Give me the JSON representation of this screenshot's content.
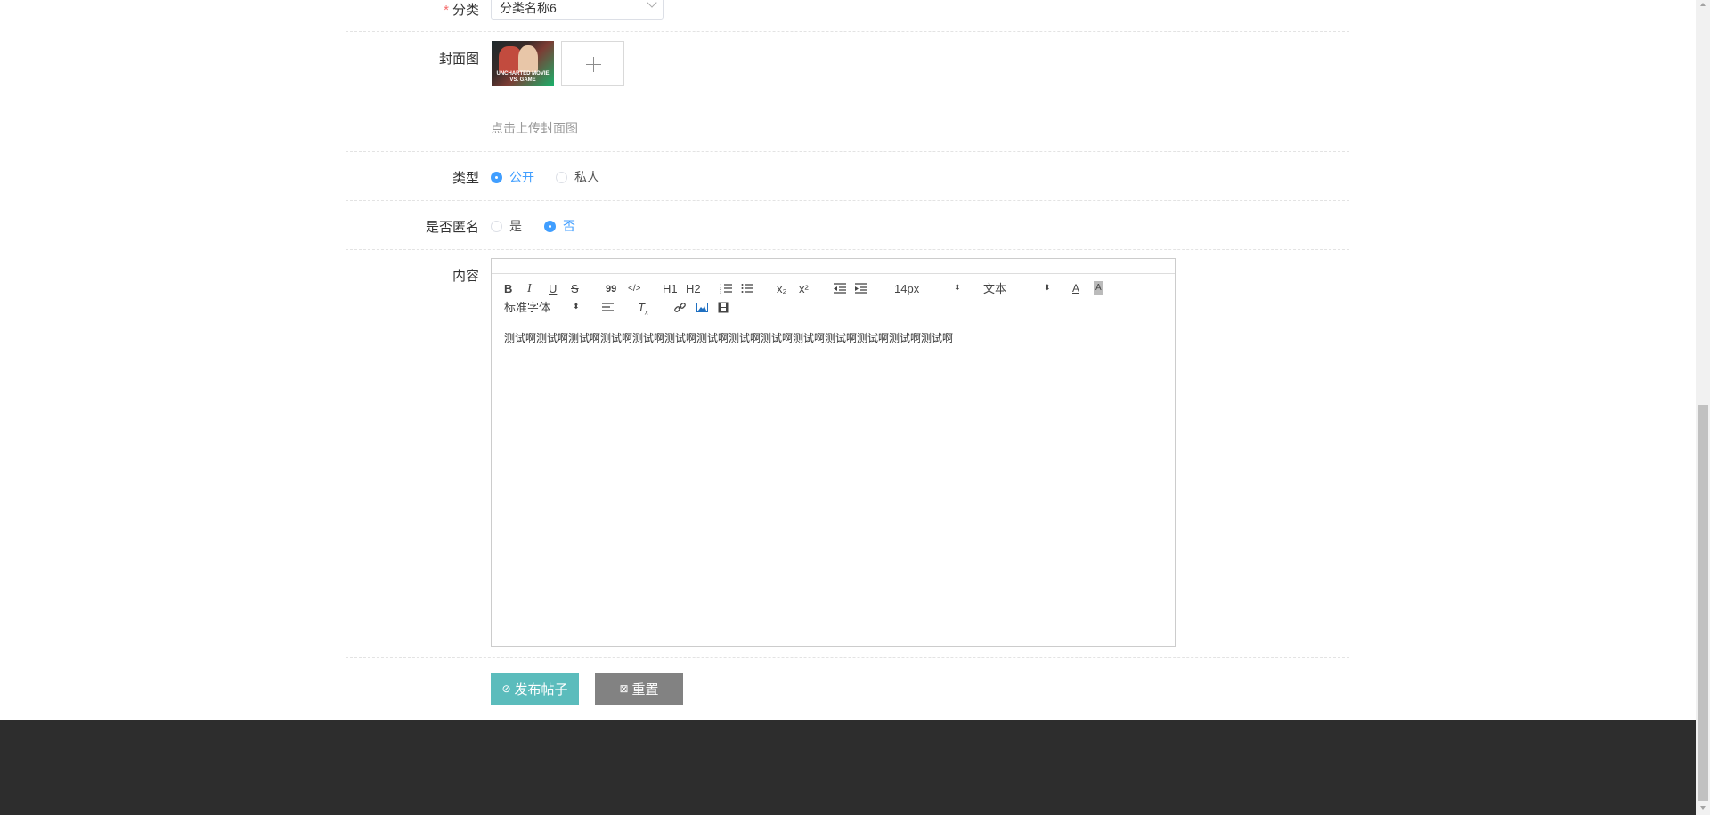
{
  "form": {
    "category": {
      "label": "分类",
      "value": "分类名称6"
    },
    "cover": {
      "label": "封面图",
      "hint": "点击上传封面图",
      "thumb_caption": "UNCHARTED MOVIE VS. GAME"
    },
    "type": {
      "label": "类型",
      "options": [
        "公开",
        "私人"
      ],
      "selected": "公开"
    },
    "anonymous": {
      "label": "是否匿名",
      "options": [
        "是",
        "否"
      ],
      "selected": "否"
    },
    "content": {
      "label": "内容"
    }
  },
  "editor": {
    "toolbar": {
      "bold": "B",
      "italic": "I",
      "underline": "U",
      "strike": "S",
      "quote": "99",
      "code": "</>",
      "h1": "H1",
      "h2": "H2",
      "sub": "x₂",
      "sup": "x²",
      "size": "14px",
      "header": "文本",
      "font": "标准字体"
    },
    "text": "测试啊测试啊测试啊测试啊测试啊测试啊测试啊测试啊测试啊测试啊测试啊测试啊测试啊测试啊"
  },
  "actions": {
    "publish": "发布帖子",
    "reset": "重置"
  },
  "colors": {
    "primary": "#5bbcbc",
    "reset": "#828282",
    "radio": "#409eff",
    "footer": "#2d2d2d"
  }
}
